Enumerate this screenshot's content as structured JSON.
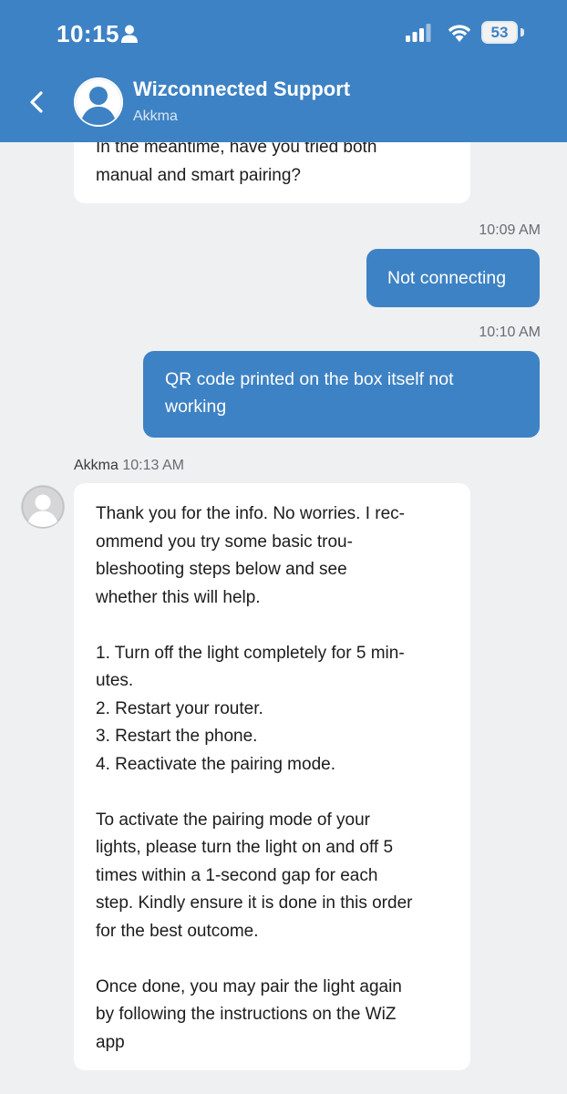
{
  "status_bar": {
    "time": "10:15",
    "battery_level": "53",
    "icons": [
      "person-icon",
      "signal-icon",
      "wifi-icon",
      "battery-icon"
    ]
  },
  "header": {
    "title": "Wizconnected Support",
    "subtitle": "Akkma",
    "back_icon": "chevron-left-icon",
    "avatar_icon": "person-avatar-icon",
    "background_color": "#3d82c4"
  },
  "messages": [
    {
      "direction": "incoming",
      "lines": [
        "In the meantime, have you tried both",
        "manual and smart pairing?"
      ]
    },
    {
      "direction": "outgoing",
      "time": "10:09 AM",
      "lines": [
        "Not connecting"
      ]
    },
    {
      "direction": "outgoing",
      "time": "10:10 AM",
      "lines": [
        "QR code printed on the box itself not",
        "working"
      ]
    },
    {
      "direction": "incoming",
      "sender": "Akkma",
      "time": "10:13 AM",
      "paragraphs": [
        [
          "Thank you for the info. No worries. I rec-",
          "ommend you try some basic trou-",
          "bleshooting steps below and see",
          "whether this will help."
        ],
        [
          "1. Turn off the light completely for 5 min-",
          "utes.",
          "2. Restart your router.",
          "3. Restart the phone.",
          "4. Reactivate the pairing mode."
        ],
        [
          "To activate the pairing mode of your",
          "lights, please turn the light on and off 5",
          "times within a 1-second gap for each",
          "step. Kindly ensure it is done in this order",
          "for the best outcome."
        ],
        [
          "Once done, you may pair the light again",
          "by following the instructions on the WiZ",
          "app"
        ]
      ]
    }
  ],
  "colors": {
    "accent": "#3d82c4",
    "background": "#eef0f2",
    "incoming_bubble": "#ffffff"
  }
}
